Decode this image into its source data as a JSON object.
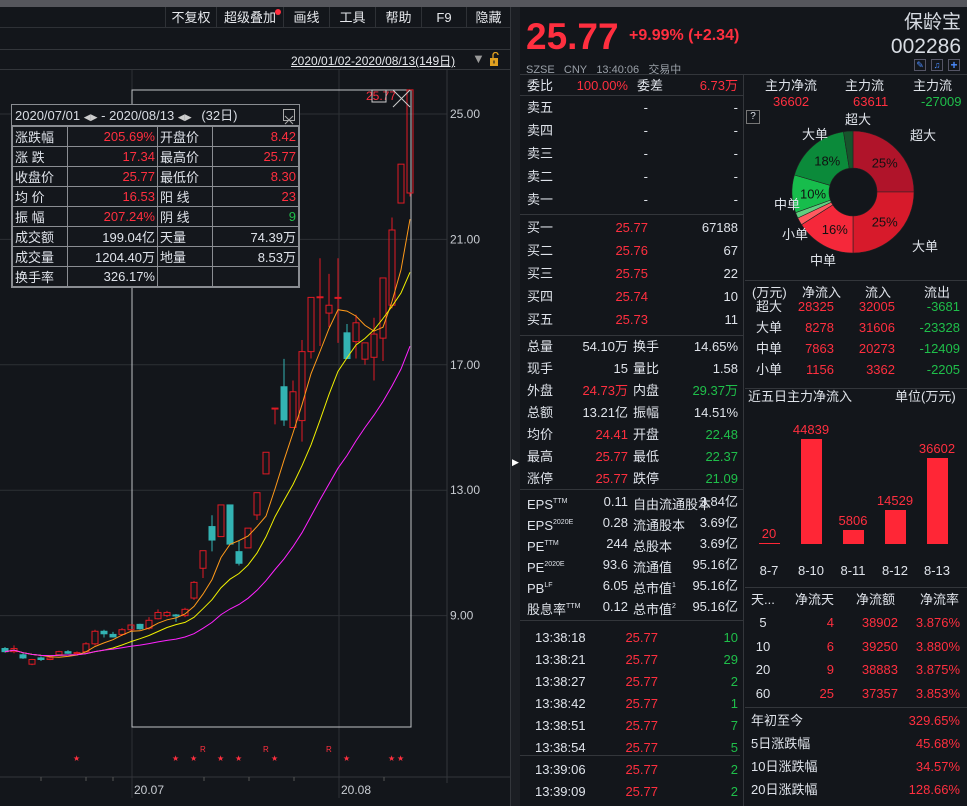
{
  "toolbar": {
    "items": [
      "不复权",
      "超级叠加",
      "画线",
      "工具",
      "帮助",
      "F9",
      "隐藏"
    ]
  },
  "chart_header": {
    "date_range": "2020/01/02-2020/08/13(149日)",
    "dropdown_icon": "triangle-down-icon",
    "lock_icon": "lock-icon"
  },
  "chart_data": {
    "type": "candlestick",
    "y_ticks": [
      "25.00",
      "21.00",
      "17.00",
      "13.00",
      "9.00"
    ],
    "y_tick_values": [
      25,
      21,
      17,
      13,
      9
    ],
    "x_ticks": [
      "20.07",
      "20.08"
    ],
    "ylim": [
      5.9,
      27.0
    ],
    "grid": true,
    "up_color": "#e01a24",
    "down_color": "#33b3b3",
    "ma_colors": [
      "#ff9a1a",
      "#f0f000",
      "#ff22ff"
    ],
    "candles": [
      [
        7.95,
        8.0,
        7.82,
        7.85
      ],
      [
        7.85,
        8.05,
        7.8,
        7.95
      ],
      [
        7.75,
        7.8,
        7.62,
        7.65
      ],
      [
        7.45,
        7.62,
        7.42,
        7.6
      ],
      [
        7.65,
        7.7,
        7.55,
        7.6
      ],
      [
        7.6,
        7.68,
        7.58,
        7.65
      ],
      [
        7.75,
        7.88,
        7.72,
        7.85
      ],
      [
        7.85,
        7.9,
        7.78,
        7.8
      ],
      [
        7.8,
        7.86,
        7.78,
        7.82
      ],
      [
        7.85,
        8.15,
        7.82,
        8.1
      ],
      [
        8.1,
        8.55,
        8.05,
        8.5
      ],
      [
        8.5,
        8.55,
        8.3,
        8.42
      ],
      [
        8.4,
        8.48,
        8.3,
        8.32
      ],
      [
        8.4,
        8.6,
        8.35,
        8.55
      ],
      [
        8.55,
        8.72,
        8.5,
        8.7
      ],
      [
        8.72,
        8.74,
        8.55,
        8.58
      ],
      [
        8.6,
        8.95,
        8.55,
        8.85
      ],
      [
        8.9,
        9.2,
        8.88,
        9.1
      ],
      [
        9.0,
        9.15,
        8.95,
        9.1
      ],
      [
        9.02,
        9.05,
        8.8,
        9.0
      ],
      [
        9.0,
        9.25,
        8.95,
        9.2
      ],
      [
        9.56,
        10.1,
        9.5,
        10.06
      ],
      [
        10.51,
        11.07,
        10.2,
        11.07
      ],
      [
        11.84,
        12.2,
        11.05,
        11.41
      ],
      [
        11.52,
        12.53,
        11.52,
        12.53
      ],
      [
        12.53,
        12.53,
        11.28,
        11.28
      ],
      [
        11.04,
        11.4,
        10.6,
        10.67
      ],
      [
        11.16,
        11.79,
        11.16,
        11.79
      ],
      [
        12.21,
        12.92,
        12.05,
        12.92
      ],
      [
        13.52,
        14.21,
        13.52,
        14.21
      ],
      [
        15.62,
        15.62,
        15.1,
        15.62
      ],
      [
        16.3,
        17.19,
        15.05,
        15.24
      ],
      [
        15.0,
        16.5,
        15.0,
        16.14
      ],
      [
        15.22,
        17.79,
        14.55,
        17.42
      ],
      [
        17.42,
        19.15,
        17.2,
        19.15
      ],
      [
        19.17,
        20.4,
        17.6,
        19.17
      ],
      [
        18.65,
        19.9,
        18.2,
        18.9
      ],
      [
        19.15,
        20.4,
        17.7,
        19.15
      ],
      [
        18.02,
        18.3,
        17.2,
        17.2
      ],
      [
        17.74,
        18.6,
        17.2,
        18.34
      ],
      [
        17.18,
        17.7,
        17.0,
        17.7
      ],
      [
        17.24,
        18.5,
        16.5,
        17.98
      ],
      [
        17.85,
        19.77,
        17.12,
        19.77
      ],
      [
        18.9,
        21.7,
        18.8,
        21.3
      ],
      [
        22.16,
        23.4,
        22.16,
        23.4
      ],
      [
        22.48,
        25.77,
        22.37,
        25.77
      ]
    ],
    "high_label": "25.77",
    "markers": {
      "stars_at_candle": [
        8,
        19,
        21,
        24,
        26,
        30,
        38,
        43,
        44
      ],
      "r_at_candle": [
        22,
        29,
        36
      ],
      "star": "★",
      "r": "R"
    }
  },
  "range_stats": {
    "start": "2020/07/01",
    "end": "2020/08/13",
    "days": "(32日)",
    "sep": "-",
    "rows": [
      [
        "涨跌幅",
        "205.69%",
        "开盘价",
        "8.42"
      ],
      [
        "涨  跌",
        "17.34",
        "最高价",
        "25.77"
      ],
      [
        "收盘价",
        "25.77",
        "最低价",
        "8.30"
      ],
      [
        "均  价",
        "16.53",
        "阳  线",
        "23"
      ],
      [
        "振  幅",
        "207.24%",
        "阴  线",
        "9"
      ],
      [
        "成交额",
        "199.04亿",
        "天量",
        "74.39万"
      ],
      [
        "成交量",
        "1204.40万",
        "地量",
        "8.53万"
      ],
      [
        "换手率",
        "326.17%",
        "",
        ""
      ]
    ],
    "row_colors": [
      [
        "red",
        "red"
      ],
      [
        "red",
        "red"
      ],
      [
        "red",
        "red"
      ],
      [
        "red",
        "red"
      ],
      [
        "red",
        "green"
      ],
      [
        "white",
        "white"
      ],
      [
        "white",
        "white"
      ],
      [
        "white",
        "white"
      ]
    ]
  },
  "quote": {
    "price": "25.77",
    "change": "+9.99% (+2.34)",
    "name": "保龄宝",
    "code": "002286",
    "exchange": "SZSE",
    "currency": "CNY",
    "time": "13:40:06",
    "status": "交易中"
  },
  "order_book": {
    "weibi_label": "委比",
    "weibi": "100.00%",
    "weicha_label": "委差",
    "weicha": "6.73万",
    "asks": [
      [
        "卖五",
        "-",
        "-"
      ],
      [
        "卖四",
        "-",
        "-"
      ],
      [
        "卖三",
        "-",
        "-"
      ],
      [
        "卖二",
        "-",
        "-"
      ],
      [
        "卖一",
        "-",
        "-"
      ]
    ],
    "bids": [
      [
        "买一",
        "25.77",
        "67188"
      ],
      [
        "买二",
        "25.76",
        "67"
      ],
      [
        "买三",
        "25.75",
        "22"
      ],
      [
        "买四",
        "25.74",
        "10"
      ],
      [
        "买五",
        "25.73",
        "11"
      ]
    ]
  },
  "stats": [
    [
      "总量",
      "54.10万",
      "white",
      "换手",
      "14.65%",
      "white"
    ],
    [
      "现手",
      "15",
      "white",
      "量比",
      "1.58",
      "white"
    ],
    [
      "外盘",
      "24.73万",
      "red",
      "内盘",
      "29.37万",
      "green"
    ],
    [
      "总额",
      "13.21亿",
      "white",
      "振幅",
      "14.51%",
      "white"
    ],
    [
      "均价",
      "24.41",
      "red",
      "开盘",
      "22.48",
      "green"
    ],
    [
      "最高",
      "25.77",
      "red",
      "最低",
      "22.37",
      "green"
    ],
    [
      "涨停",
      "25.77",
      "red",
      "跌停",
      "21.09",
      "green"
    ]
  ],
  "fundamentals": [
    [
      "EPS",
      "TTM",
      "0.11",
      "自由流通股本",
      "",
      "3.84亿"
    ],
    [
      "EPS",
      "2020E",
      "0.28",
      "流通股本",
      "",
      "3.69亿"
    ],
    [
      "PE",
      "TTM",
      "244",
      "总股本",
      "",
      "3.69亿"
    ],
    [
      "PE",
      "2020E",
      "93.6",
      "流通值",
      "",
      "95.16亿"
    ],
    [
      "PB",
      "LF",
      "6.05",
      "总市值",
      "1",
      "95.16亿"
    ],
    [
      "股息率",
      "TTM",
      "0.12",
      "总市值",
      "2",
      "95.16亿"
    ]
  ],
  "ticks": [
    [
      "13:38:18",
      "25.77",
      "10"
    ],
    [
      "13:38:21",
      "25.77",
      "29"
    ],
    [
      "13:38:27",
      "25.77",
      "2"
    ],
    [
      "13:38:42",
      "25.77",
      "1"
    ],
    [
      "13:38:51",
      "25.77",
      "7"
    ],
    [
      "13:38:54",
      "25.77",
      "5"
    ],
    [
      "13:39:06",
      "25.77",
      "2"
    ],
    [
      "13:39:09",
      "25.77",
      "2"
    ]
  ],
  "main_flow": {
    "headers": [
      "主力净流",
      "主力流",
      "主力流"
    ],
    "values": [
      "36602",
      "63611",
      "-27009"
    ],
    "help": "?",
    "pie": [
      {
        "label": "超大",
        "pct": 25,
        "color": "#b0142a",
        "text": "25%"
      },
      {
        "label": "大单",
        "pct": 25,
        "color": "#d71a2b",
        "text": "25%"
      },
      {
        "label": "中单",
        "pct": 16,
        "color": "#f5283a",
        "text": "16%"
      },
      {
        "label": "小单",
        "pct": 2,
        "color": "#ff5a60",
        "text": ""
      },
      {
        "label": "小单",
        "pct": 1.5,
        "color": "#5fcf7f",
        "text": ""
      },
      {
        "label": "中单",
        "pct": 10,
        "color": "#17bd4c",
        "text": "10%"
      },
      {
        "label": "大单",
        "pct": 18,
        "color": "#0b8a3a",
        "text": "18%"
      },
      {
        "label": "超大",
        "pct": 2.5,
        "color": "#17552c",
        "text": ""
      }
    ],
    "pie_labels": [
      "超大",
      "超大",
      "大单",
      "中单",
      "小单",
      "中单",
      "大单"
    ]
  },
  "flow_table": {
    "headers": [
      "(万元)",
      "净流入",
      "流入",
      "流出"
    ],
    "rows": [
      [
        "超大",
        "28325",
        "32005",
        "-3681"
      ],
      [
        "大单",
        "8278",
        "31606",
        "-23328"
      ],
      [
        "中单",
        "7863",
        "20273",
        "-12409"
      ],
      [
        "小单",
        "1156",
        "3362",
        "-2205"
      ]
    ]
  },
  "five_day": {
    "title": "近五日主力净流入",
    "unit": "单位(万元)",
    "categories": [
      "8-7",
      "8-10",
      "8-11",
      "8-12",
      "8-13"
    ],
    "values": [
      20,
      44839,
      5806,
      14529,
      36602
    ],
    "labels": [
      "20",
      "44839",
      "5806",
      "14529",
      "36602"
    ]
  },
  "period_table": {
    "headers": [
      "天...",
      "净流天",
      "净流额",
      "净流率"
    ],
    "rows": [
      [
        "5",
        "4",
        "38902",
        "3.876%"
      ],
      [
        "10",
        "6",
        "39250",
        "3.880%"
      ],
      [
        "20",
        "9",
        "38883",
        "3.875%"
      ],
      [
        "60",
        "25",
        "37357",
        "3.853%"
      ]
    ]
  },
  "performance": [
    [
      "年初至今",
      "329.65%"
    ],
    [
      "5日涨跌幅",
      "45.68%"
    ],
    [
      "10日涨跌幅",
      "34.57%"
    ],
    [
      "20日涨跌幅",
      "128.66%"
    ]
  ]
}
